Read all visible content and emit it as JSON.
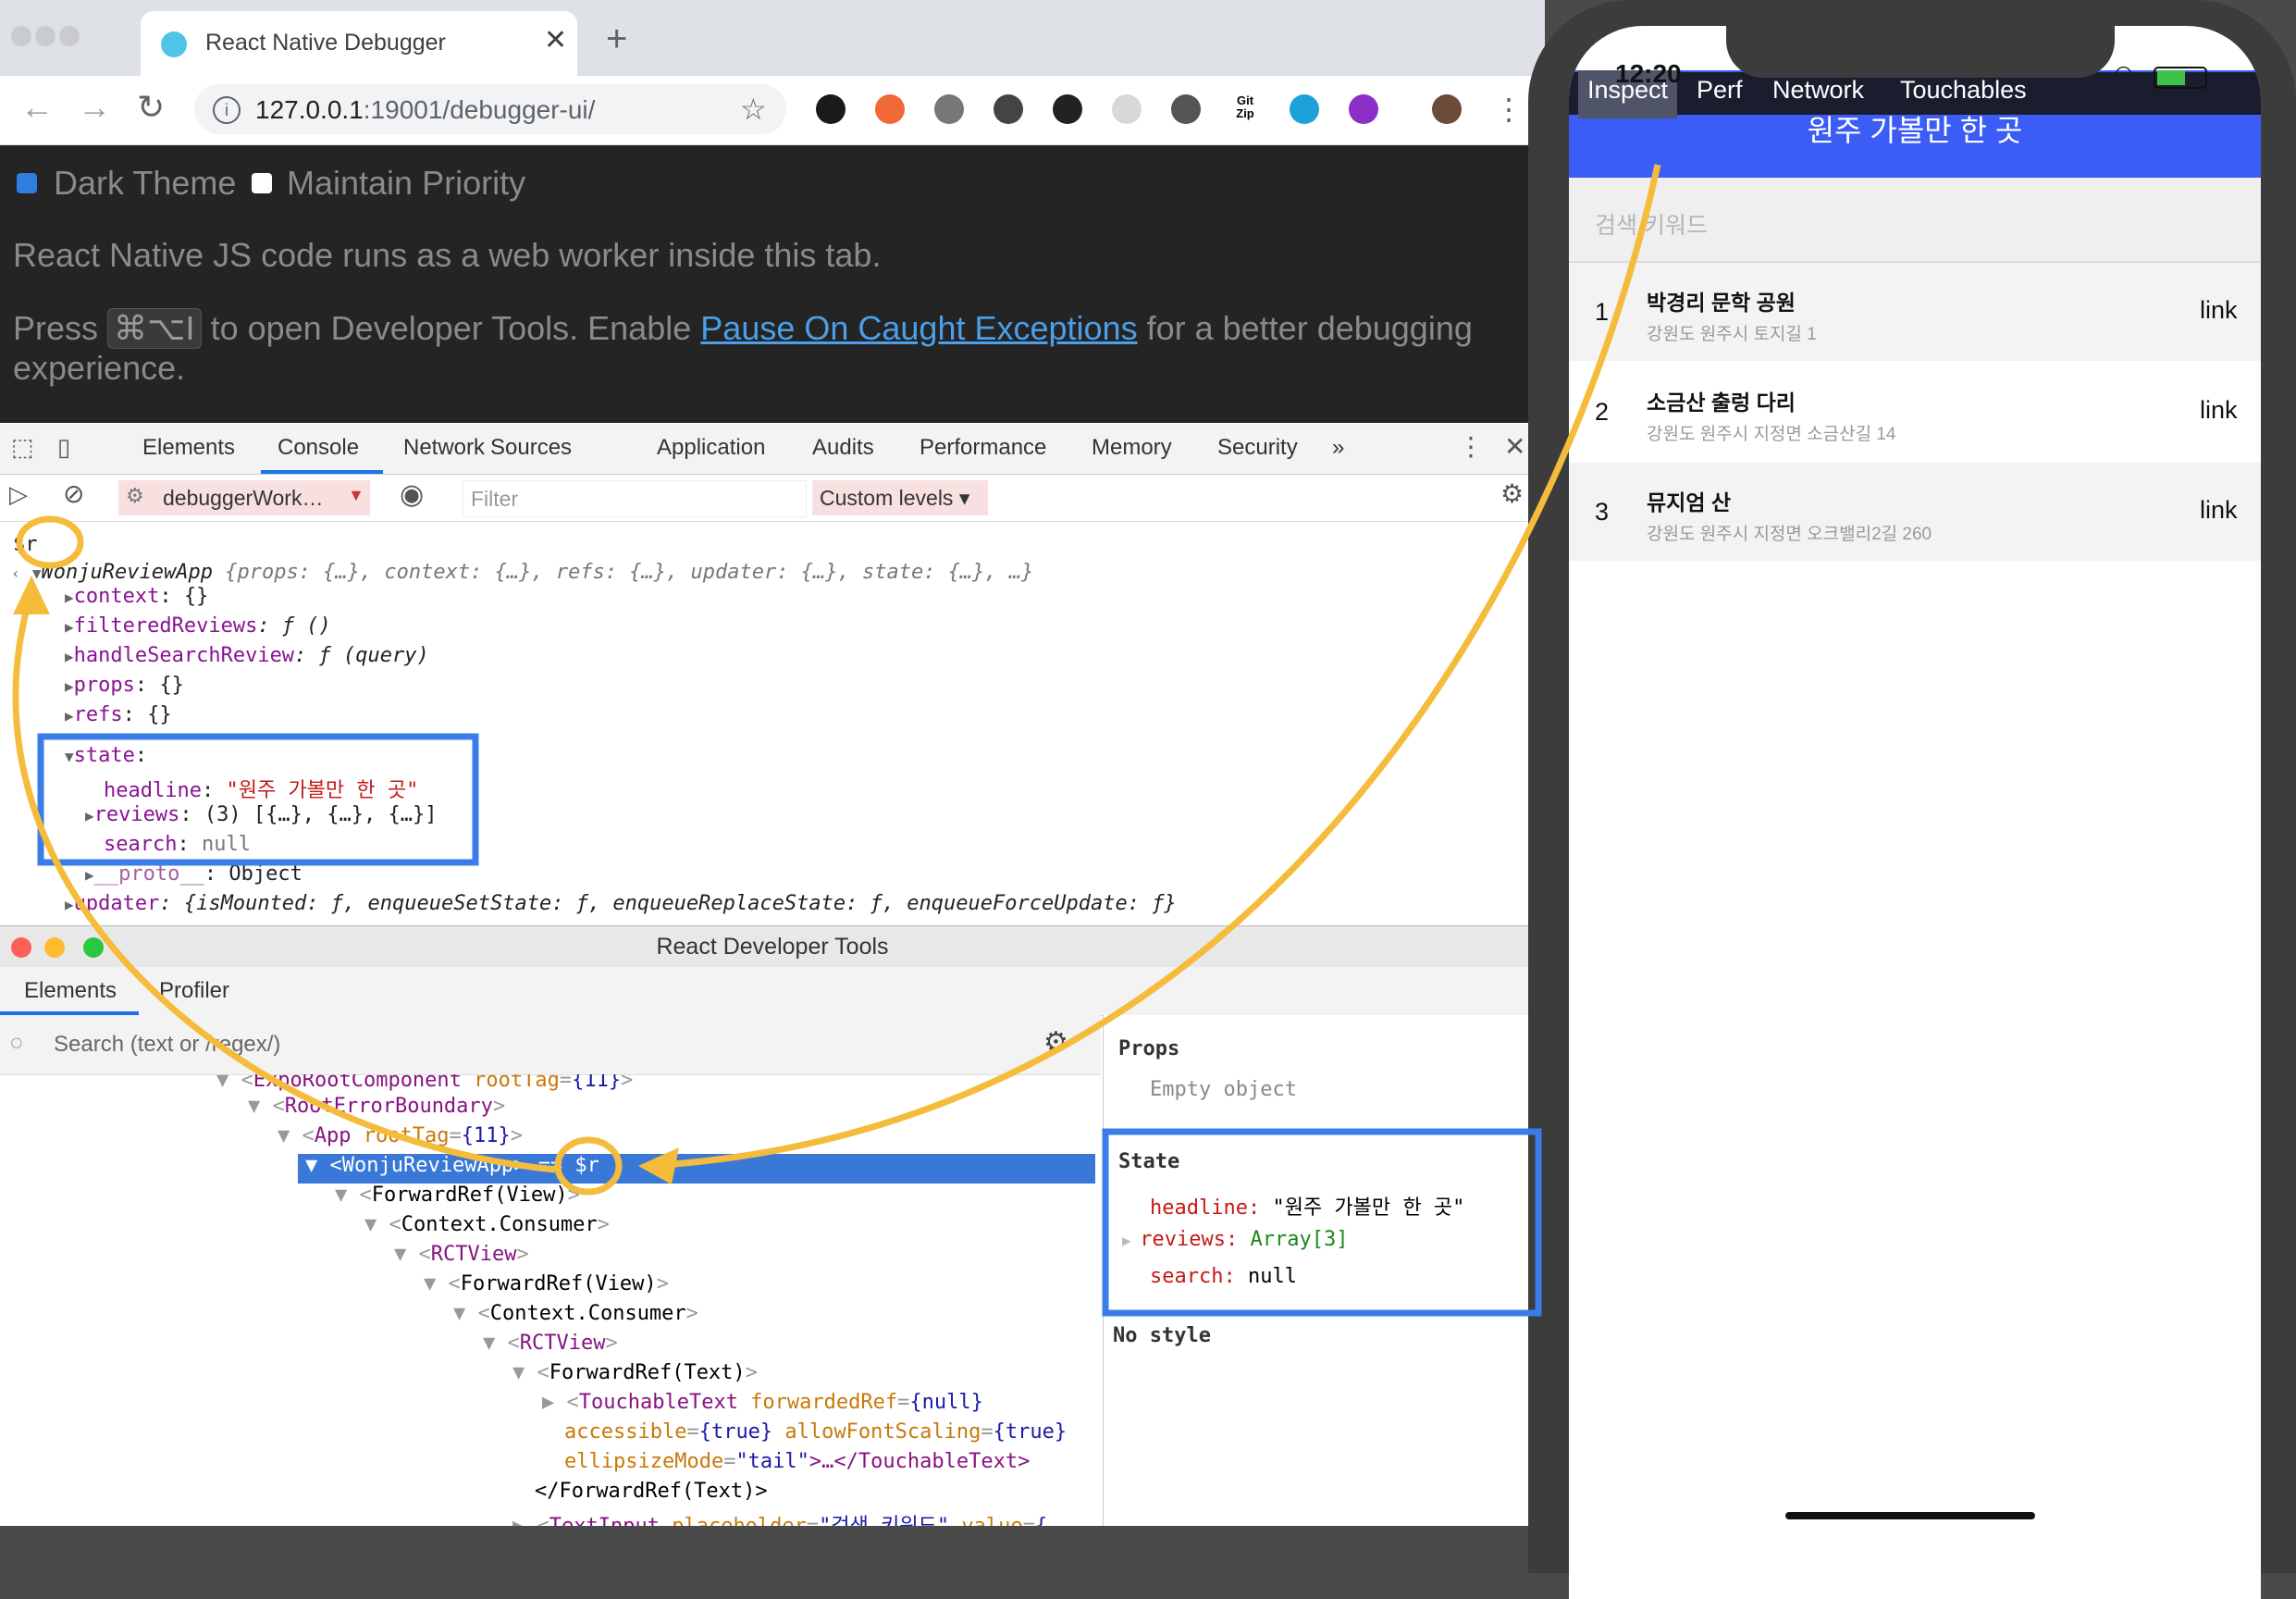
{
  "browser": {
    "tab_title": "React Native Debugger",
    "tab_close": "✕",
    "new_tab": "+",
    "url_host": "127.0.0.1",
    "url_rest": ":19001/debugger-ui/",
    "back": "←",
    "forward": "→",
    "reload": "↻",
    "star": "☆",
    "menu": "⋮",
    "extensions": [
      "star-ext-icon",
      "b-ext-icon",
      "camera-ext-icon",
      "bulb-ext-icon",
      "record-ext-icon",
      "react-ext-icon",
      "vue-ext-icon",
      "gitzip-ext-icon",
      "drop-ext-icon",
      "face-ext-icon",
      "avatar-ext-icon"
    ],
    "ext_colors": [
      "#1a1a1a",
      "#f06a35",
      "#777777",
      "#444444",
      "#222222",
      "#d8d8d8",
      "#555555",
      "#ffffff",
      "#1ea0d8",
      "#8b2fc9",
      "#6b4b3a"
    ],
    "gitzip_label": "Git\nZip"
  },
  "debugger_page": {
    "dark_theme_label": "Dark Theme",
    "maintain_priority_label": "Maintain Priority",
    "line1": "React Native JS code runs as a web worker inside this tab.",
    "press": "Press",
    "shortcut": "⌘⌥I",
    "line2_mid": "to open Developer Tools. Enable",
    "link_text": "Pause On Caught Exceptions",
    "line2_end": "for a better debugging",
    "line3": "experience."
  },
  "devtools": {
    "tabs": [
      "Elements",
      "Console",
      "Network",
      "Sources",
      "Application",
      "Audits",
      "Performance",
      "Memory",
      "Security",
      "»"
    ],
    "context": "debuggerWork…",
    "filter_placeholder": "Filter",
    "levels": "Custom levels ▾",
    "console": {
      "input": "$r",
      "root": "WonjuReviewApp",
      "root_summary": " {props: {…}, context: {…}, refs: {…}, updater: {…}, state: {…}, …}",
      "context_key": "context",
      "context_val": ": {}",
      "filtered_key": "filteredReviews",
      "fn_val": ": ƒ ()",
      "handle_key": "handleSearchReview",
      "handle_val": ": ƒ (query)",
      "props_key": "props",
      "props_val": ": {}",
      "refs_key": "refs",
      "refs_val": ": {}",
      "state_key": "state",
      "headline_key": "headline",
      "headline_val": "\"원주 가볼만 한 곳\"",
      "reviews_key": "reviews",
      "reviews_val": ": (3) [{…}, {…}, {…}]",
      "search_key": "search",
      "search_val": "null",
      "proto_key": "__proto__",
      "proto_val": ": Object",
      "updater_key": "updater",
      "updater_val": ": {isMounted: ƒ, enqueueSetState: ƒ, enqueueReplaceState: ƒ, enqueueForceUpdate: ƒ}"
    }
  },
  "react_devtools": {
    "title": "React Developer Tools",
    "tabs": [
      "Elements",
      "Profiler"
    ],
    "search_placeholder": "Search (text or /regex/)",
    "tree": {
      "expo_root": "ExpoRootComponent",
      "root_tag_attr": " rootTag",
      "root_tag_val": "{11}",
      "root_error": "RootErrorBoundary",
      "app": "App",
      "selected": "WonjuReviewApp",
      "selected_suffix": "== $r",
      "fwd_view": "ForwardRef(View)",
      "ctx_consumer": "Context.Consumer",
      "rct_view": "RCTView",
      "fwd_text": "ForwardRef(Text)",
      "touchable": "TouchableText",
      "fwd_ref_attr": " forwardedRef",
      "null_val": "{null}",
      "accessible_attr": "accessible",
      "true_val": "{true}",
      "font_scaling_attr": " allowFontScaling",
      "ellipsize_attr": "ellipsizeMode",
      "tail_val": "\"tail\"",
      "touchable_close": ">…</TouchableText>",
      "fwd_text_close": "</ForwardRef(Text)>",
      "text_input": "TextInput",
      "placeholder_attr": " placeholder",
      "placeholder_val": "\"검색 키워드\"",
      "value_attr": " value",
      "value_val": "{"
    },
    "props_title": "Props",
    "props_empty": "Empty object",
    "state_title": "State",
    "state": {
      "headline_key": "headline:",
      "headline_val": "\"원주 가볼만 한 곳\"",
      "reviews_key": "reviews:",
      "reviews_val": "Array[3]",
      "search_key": "search:",
      "search_val": "null"
    },
    "no_style": "No style"
  },
  "phone": {
    "time": "12:20",
    "inspector_tabs": [
      "Inspect",
      "Perf",
      "Network",
      "Touchables"
    ],
    "header_title": "원주 가볼만 한 곳",
    "search_placeholder": "검색 키워드",
    "items": [
      {
        "num": "1",
        "name": "박경리 문학 공원",
        "addr": "강원도 원주시 토지길 1",
        "link": "link"
      },
      {
        "num": "2",
        "name": "소금산 출렁 다리",
        "addr": "강원도 원주시 지정면 소금산길 14",
        "link": "link"
      },
      {
        "num": "3",
        "name": "뮤지엄 산",
        "addr": "강원도 원주시 지정면 오크밸리2길 260",
        "link": "link"
      }
    ]
  },
  "colors": {
    "annotation_orange": "#f5bc3c",
    "annotation_blue": "#3a7de8",
    "phone_header": "#3b5cf5",
    "selection": "#3a78d8"
  }
}
